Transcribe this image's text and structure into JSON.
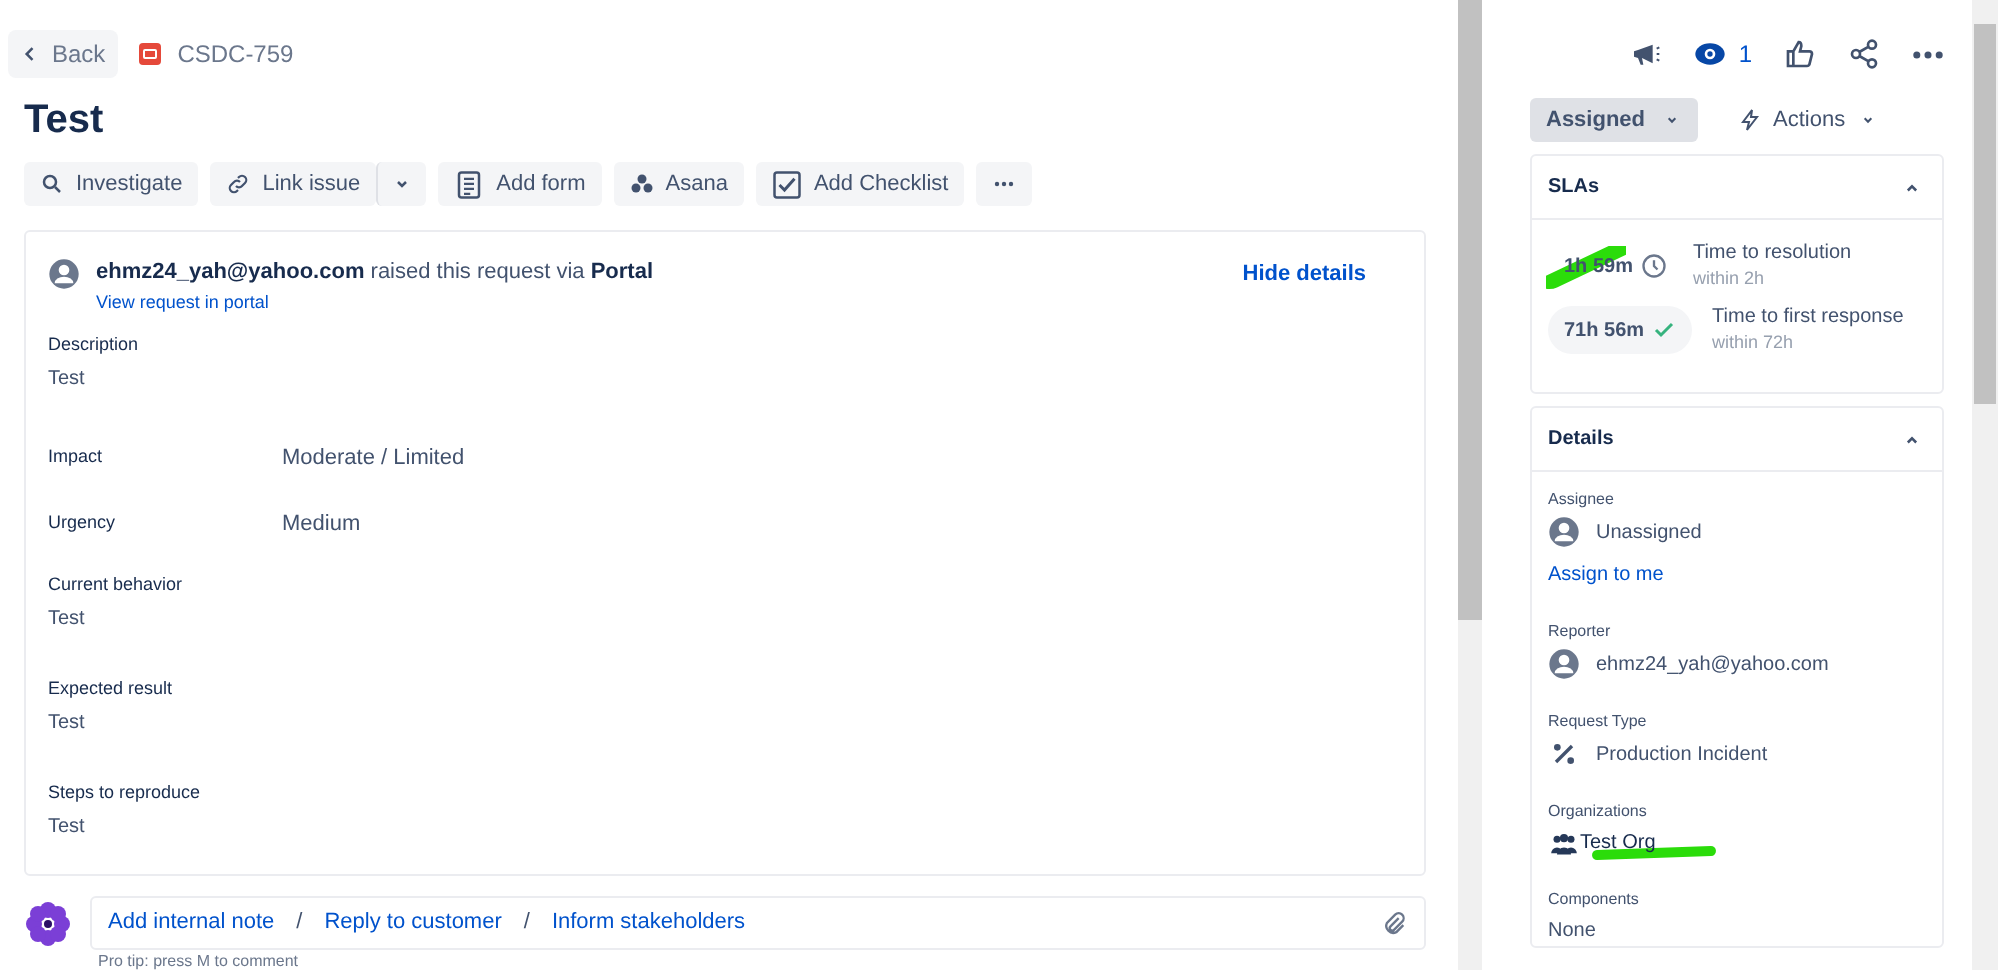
{
  "breadcrumb": {
    "back": "Back",
    "issue_key": "CSDC-759"
  },
  "title": "Test",
  "toolbar": [
    {
      "kind": "search",
      "label": "Investigate"
    },
    {
      "kind": "link",
      "label": "Link issue"
    },
    {
      "kind": "dropdown"
    },
    {
      "kind": "form",
      "label": "Add form"
    },
    {
      "kind": "asana",
      "label": "Asana"
    },
    {
      "kind": "checklist",
      "label": "Add Checklist"
    },
    {
      "kind": "more"
    }
  ],
  "request": {
    "reporter": "ehmz24_yah@yahoo.com",
    "raised_text": "raised this request via",
    "channel": "Portal",
    "view_link": "View request in portal",
    "hide_link": "Hide details"
  },
  "fields": [
    {
      "kind": "stacked",
      "label": "Description",
      "value": "Test"
    },
    {
      "kind": "inline",
      "label": "Impact",
      "value": "Moderate / Limited"
    },
    {
      "kind": "inline",
      "label": "Urgency",
      "value": "Medium"
    },
    {
      "kind": "stacked",
      "label": "Current behavior",
      "value": "Test"
    },
    {
      "kind": "stacked",
      "label": "Expected result",
      "value": "Test"
    },
    {
      "kind": "stacked",
      "label": "Steps to reproduce",
      "value": "Test"
    }
  ],
  "comment_actions": [
    "Add internal note",
    "Reply to customer",
    "Inform stakeholders"
  ],
  "comment_separators": [
    "/",
    "/"
  ],
  "pro_tip": "Pro tip: press M to comment",
  "header_actions": {
    "watchers": "1"
  },
  "status": "Assigned",
  "actions": "Actions",
  "slas": {
    "title": "SLAs",
    "items": [
      {
        "time": "1h 59m",
        "kind": "running",
        "name": "Time to resolution",
        "goal": "within 2h",
        "highlighted": true
      },
      {
        "time": "71h 56m",
        "kind": "met",
        "name": "Time to first response",
        "goal": "within 72h",
        "highlighted": false
      }
    ]
  },
  "details": {
    "title": "Details",
    "assignee_label": "Assignee",
    "assignee": "Unassigned",
    "assign_link": "Assign to me",
    "reporter_label": "Reporter",
    "reporter": "ehmz24_yah@yahoo.com",
    "type_label": "Request Type",
    "type": "Production Incident",
    "org_label": "Organizations",
    "org": "Test Org",
    "org_highlighted": true,
    "components_label": "Components",
    "components": "None"
  }
}
